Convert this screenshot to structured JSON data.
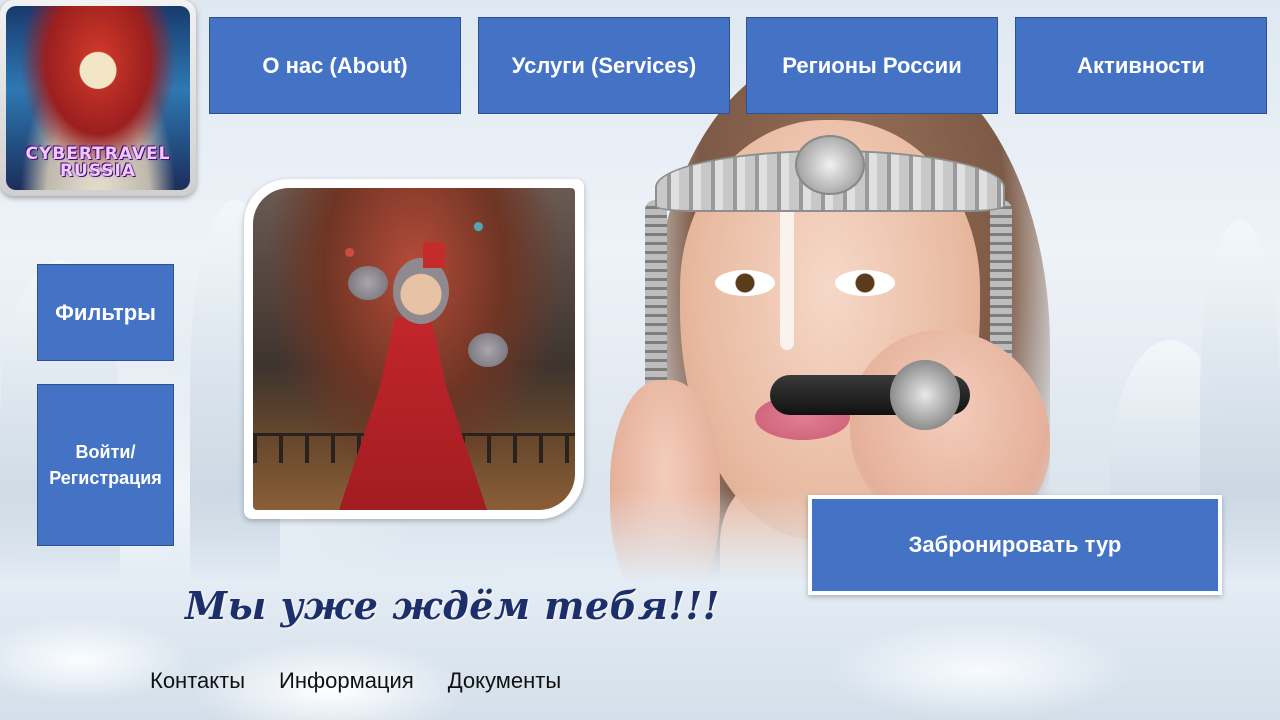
{
  "logo": {
    "text_line1": "CYBERTRAVEL",
    "text_line2": "RUSSIA"
  },
  "nav": {
    "about": "О нас (About)",
    "services": "Услуги (Services)",
    "regions": "Регионы России",
    "activities": "Активности"
  },
  "sidebar": {
    "filters": "Фильтры",
    "login_line1": "Войти/",
    "login_line2": "Регистрация"
  },
  "cta": {
    "book_tour": "Забронировать тур"
  },
  "tagline": "Мы уже ждём тебя!!!",
  "footer": {
    "links": [
      "Контакты",
      "Информация",
      "Документы"
    ]
  },
  "colors": {
    "button_blue": "#4472c4",
    "button_border": "#2f528f",
    "tagline": "#1d2f6a"
  }
}
